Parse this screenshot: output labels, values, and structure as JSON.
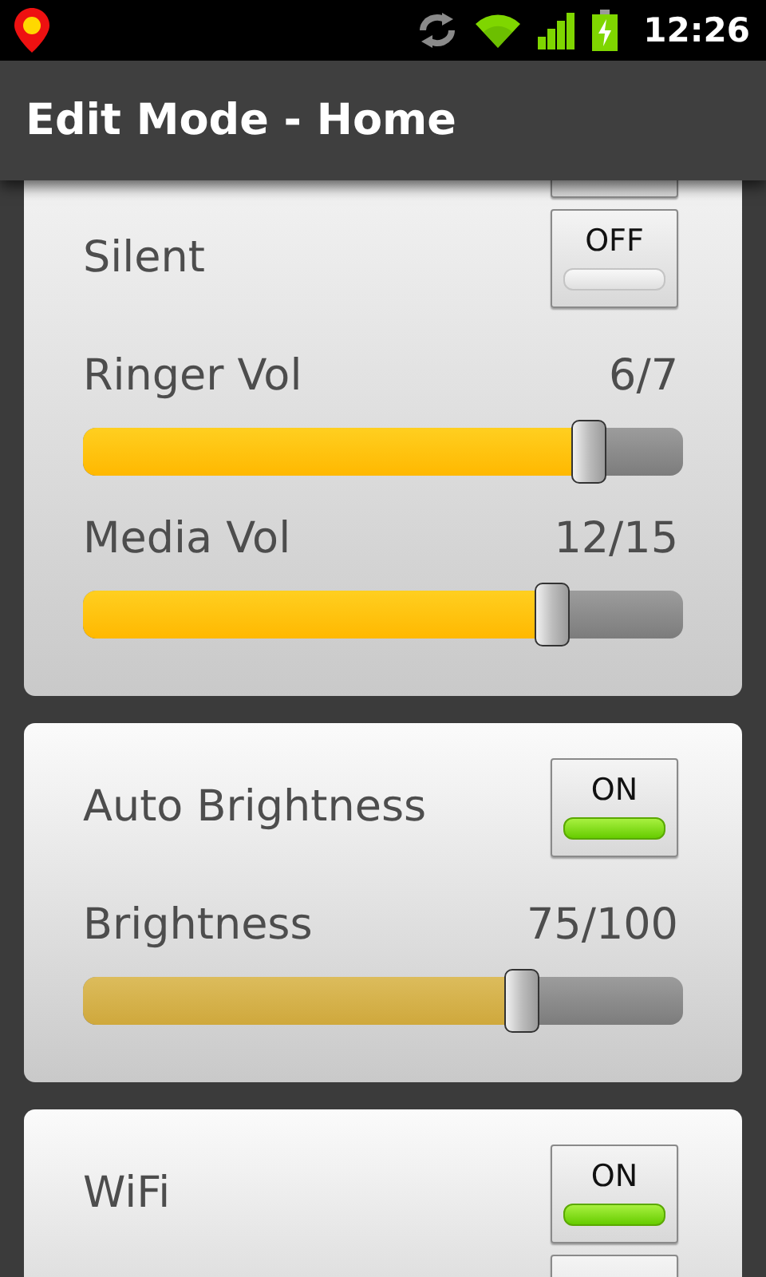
{
  "status_bar": {
    "time": "12:26"
  },
  "title": "Edit Mode - Home",
  "cards": [
    {
      "items": [
        {
          "kind": "toggle"
        },
        {
          "kind": "toggle",
          "label": "Silent",
          "state_label": "OFF",
          "on": false
        },
        {
          "kind": "slider",
          "label": "Ringer Vol",
          "reading": "6/7",
          "level": 0.84,
          "disabled": false
        },
        {
          "kind": "slider",
          "label": "Media Vol",
          "reading": "12/15",
          "level": 0.78,
          "disabled": false
        }
      ]
    },
    {
      "items": [
        {
          "kind": "toggle",
          "label": "Auto Brightness",
          "state_label": "ON",
          "on": true
        },
        {
          "kind": "slider",
          "label": "Brightness",
          "reading": "75/100",
          "level": 0.73,
          "disabled": true
        }
      ]
    },
    {
      "items": [
        {
          "kind": "toggle",
          "label": "WiFi",
          "state_label": "ON",
          "on": true
        },
        {
          "kind": "toggle"
        }
      ]
    }
  ]
}
